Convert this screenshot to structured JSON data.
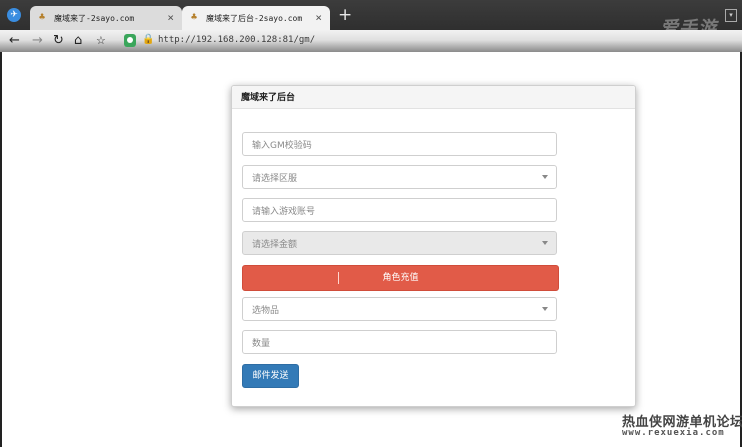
{
  "browser": {
    "tabs": [
      {
        "title": "魔域来了-2sayo.com",
        "close": "×"
      },
      {
        "title": "魔域来了后台-2sayo.com",
        "close": "×"
      }
    ],
    "new_tab": "+",
    "url": "http://192.168.200.128:81/gm/"
  },
  "panel": {
    "title": "魔域来了后台",
    "gm_code_placeholder": "输入GM校验码",
    "server_select": "请选择区服",
    "account_placeholder": "请输入游戏账号",
    "amount_select": "请选择金额",
    "recharge_button": "角色充值",
    "item_select": "选物品",
    "quantity_placeholder": "数量",
    "mail_button": "邮件发送"
  },
  "watermark": {
    "top": "爱手游",
    "site_name": "热血侠网游单机论坛",
    "site_url": "www.rexuexia.com"
  },
  "colors": {
    "danger": "#e15b48",
    "primary": "#337ab7"
  }
}
